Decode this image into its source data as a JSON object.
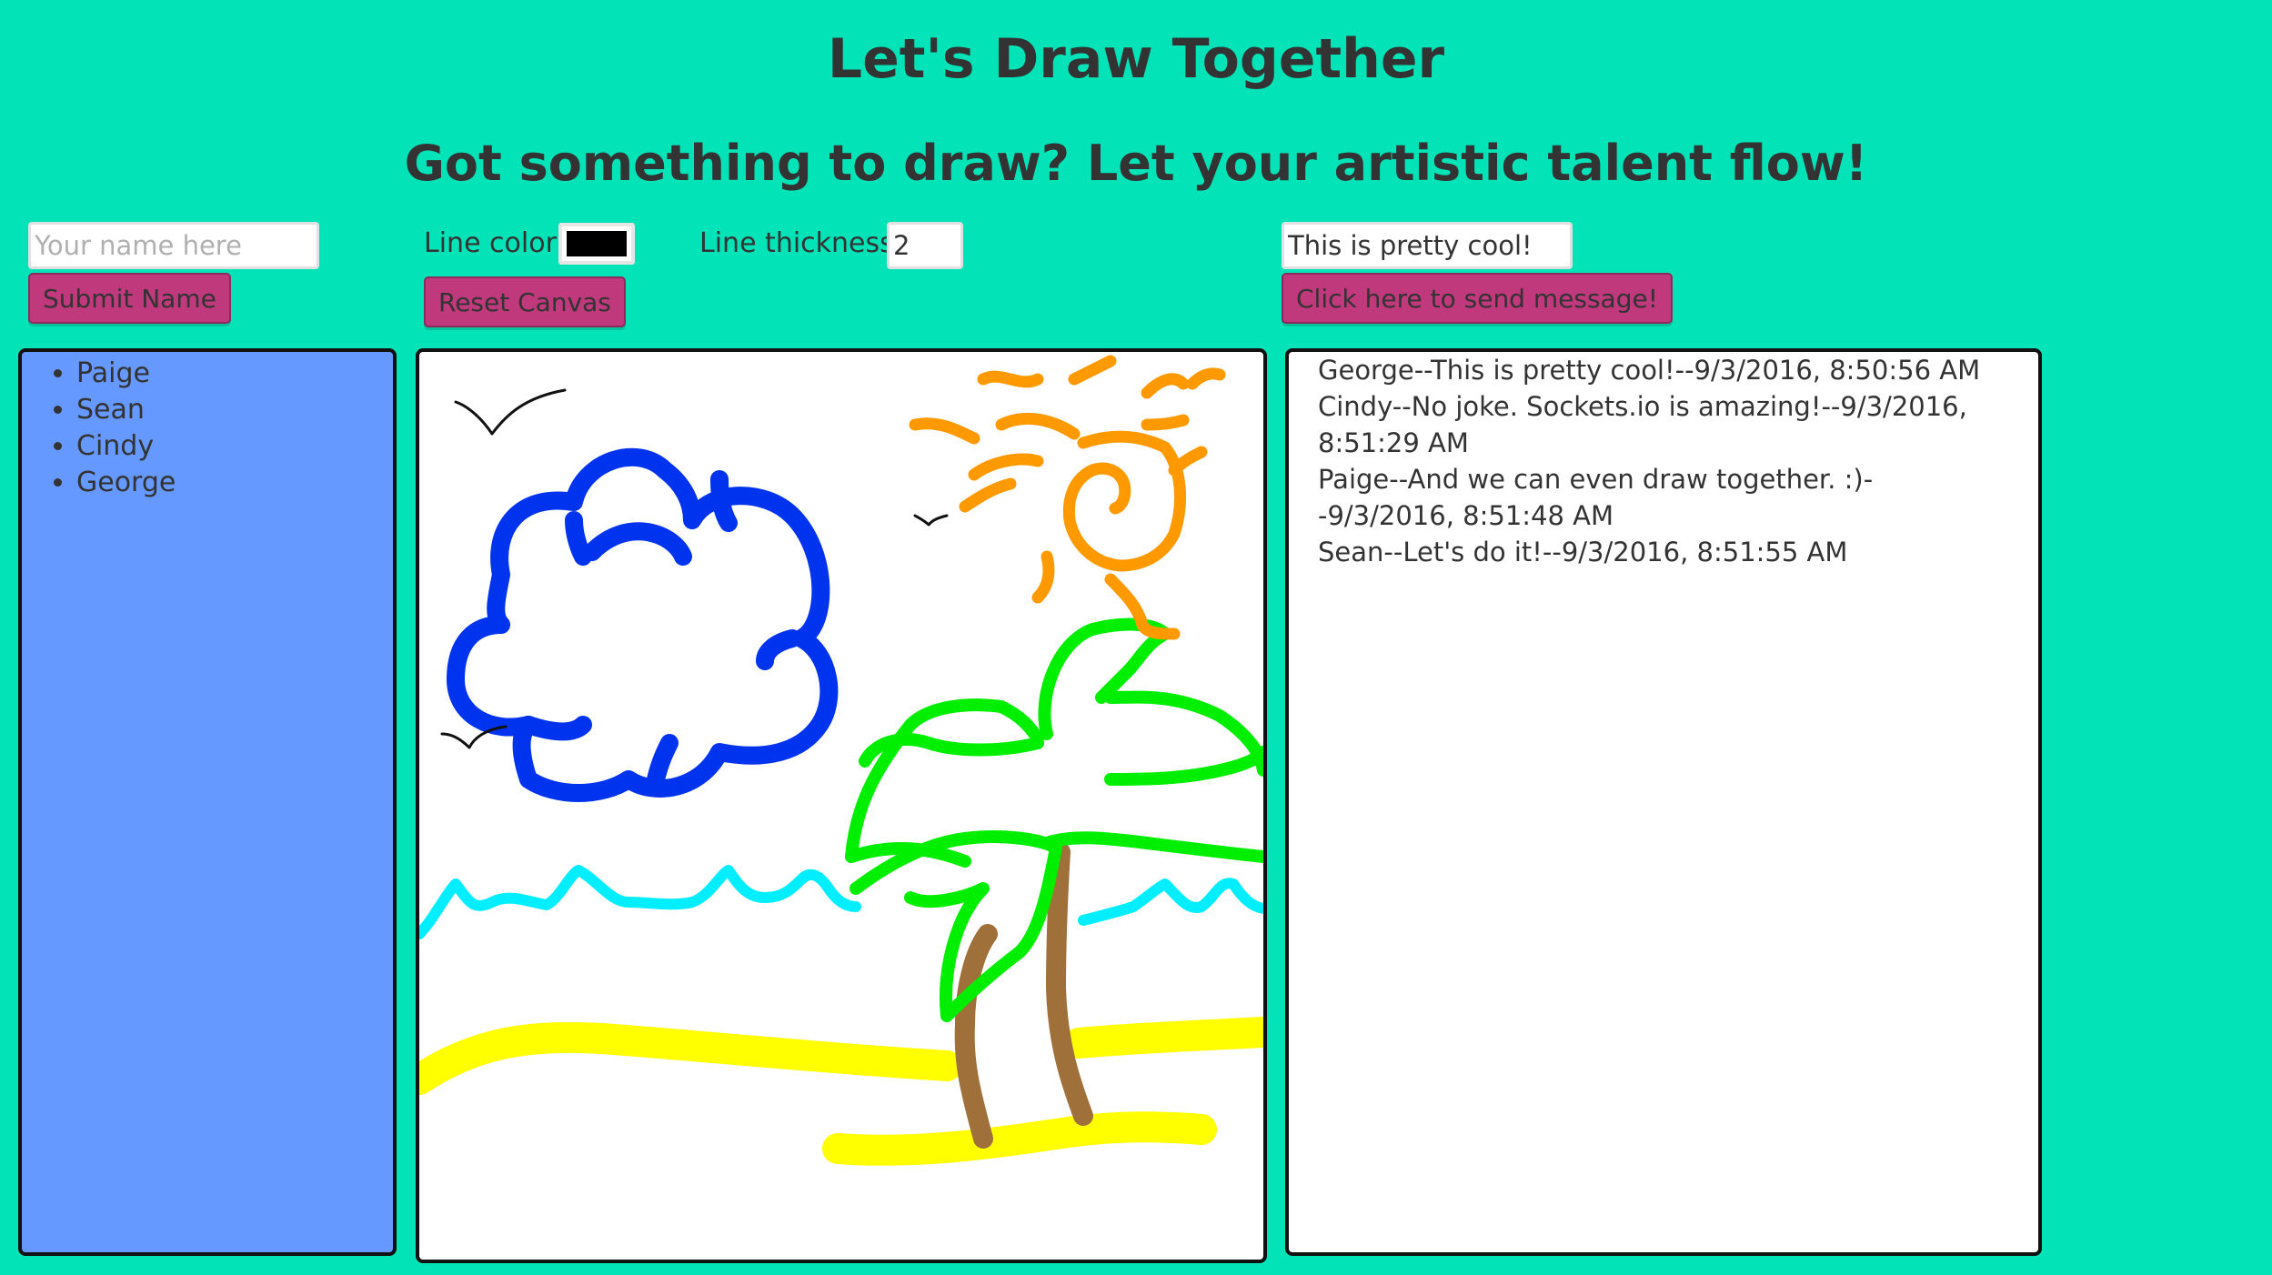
{
  "header": {
    "title": "Let's Draw Together",
    "subtitle": "Got something to draw? Let your artistic talent flow!"
  },
  "name_form": {
    "placeholder": "Your name here",
    "value": "",
    "submit_label": "Submit Name"
  },
  "draw_controls": {
    "line_color_label": "Line color",
    "line_color_value": "#000000",
    "line_thickness_label": "Line thickness",
    "line_thickness_value": "2",
    "reset_label": "Reset Canvas"
  },
  "chat_form": {
    "message_value": "This is pretty cool!",
    "send_label": "Click here to send message!"
  },
  "users": [
    "Paige",
    "Sean",
    "Cindy",
    "George"
  ],
  "messages": [
    "George--This is pretty cool!--9/3/2016, 8:50:56 AM",
    "Cindy--No joke. Sockets.io is amazing!--9/3/2016, 8:51:29 AM",
    "Paige--And we can even draw together. :)--9/3/2016, 8:51:48 AM",
    "Sean--Let's do it!--9/3/2016, 8:51:55 AM"
  ],
  "colors": {
    "background": "#02e4b8",
    "button": "#c0397c",
    "users_panel": "#6699ff",
    "cloud": "#0033ee",
    "sun": "#ff9900",
    "palm_leaves": "#00ee00",
    "trunk": "#a0703a",
    "waves": "#00eeff",
    "sand": "#ffff00",
    "birds": "#111111"
  }
}
